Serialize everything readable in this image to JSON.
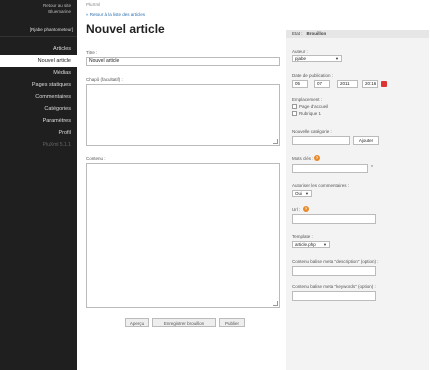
{
  "sidebar": {
    "site_link_line1": "Retour au site",
    "site_link_line2": "Bluemarine",
    "user": "[Rjabe phantometeur]",
    "items": [
      {
        "label": "Articles"
      },
      {
        "label": "Nouvel article",
        "active": true
      },
      {
        "label": "Médias"
      },
      {
        "label": "Pages statiques"
      },
      {
        "label": "Commentaires"
      },
      {
        "label": "Catégories"
      },
      {
        "label": "Paramètres"
      },
      {
        "label": "Profil"
      }
    ],
    "version": "PluXml 5.1.1"
  },
  "main": {
    "crumb": "PluXml",
    "back_link": "« Retour à la liste des articles",
    "title": "Nouvel article",
    "title_label": "Titre :",
    "title_value": "Nouvel article",
    "chapo_label": "Chapô (facultatif) :",
    "content_label": "Contenu :",
    "buttons": {
      "preview": "Aperçu",
      "draft": "Enregistrer brouillon",
      "publish": "Publier"
    }
  },
  "panel": {
    "status_label": "Etat :",
    "status_value": "Brouillon",
    "author_label": "Auteur :",
    "author_value": "pjabe",
    "date_label": "Date de publication :",
    "date_day": "05",
    "date_month": "07",
    "date_year": "2011",
    "date_time": "20:16",
    "placement_label": "Emplacement :",
    "placement_options": [
      "Page d'accueil",
      "Rubrique 1"
    ],
    "new_cat_label": "Nouvelle catégorie :",
    "add_button": "Ajouter",
    "tags_label": "Mots clés :",
    "allow_comments_label": "Autoriser les commentaires :",
    "allow_comments_value": "Oui",
    "url_label": "Url :",
    "template_label": "Template :",
    "template_value": "article.php",
    "meta_desc_label": "Contenu balise meta \"description\" (option) :",
    "meta_keywords_label": "Contenu balise meta \"keywords\" (option) :"
  },
  "colors": {
    "sidebar_bg": "#1f1f1f",
    "link": "#2a6fb0",
    "help_icon": "#e88a2a",
    "calendar_icon": "#dd3333"
  }
}
